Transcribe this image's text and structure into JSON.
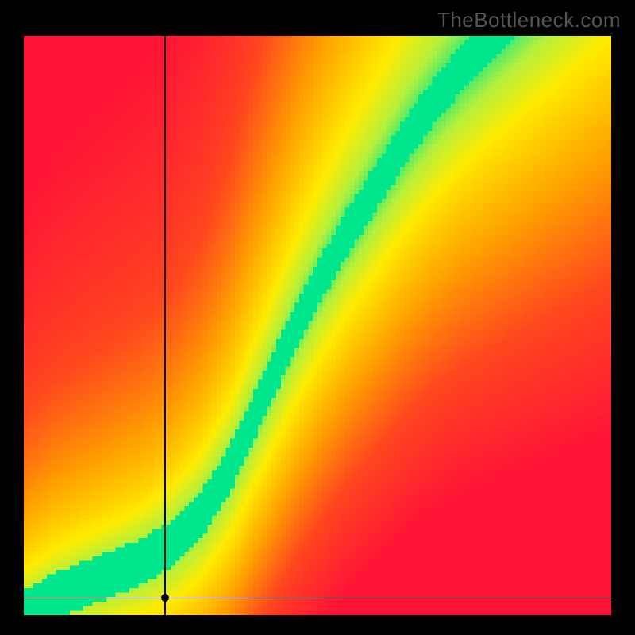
{
  "watermark": "TheBottleneck.com",
  "chart_data": {
    "type": "heatmap",
    "title": "",
    "xlabel": "",
    "ylabel": "",
    "xlim": [
      0,
      100
    ],
    "ylim": [
      0,
      100
    ],
    "grid_cells": 128,
    "colormap_description": "red→orange→yellow→green (distance from optimal curve)",
    "optimal_curve": [
      {
        "x": 0,
        "y": 0
      },
      {
        "x": 5,
        "y": 3
      },
      {
        "x": 10,
        "y": 5
      },
      {
        "x": 15,
        "y": 7
      },
      {
        "x": 20,
        "y": 9
      },
      {
        "x": 25,
        "y": 12
      },
      {
        "x": 30,
        "y": 17
      },
      {
        "x": 35,
        "y": 25
      },
      {
        "x": 40,
        "y": 36
      },
      {
        "x": 45,
        "y": 47
      },
      {
        "x": 50,
        "y": 57
      },
      {
        "x": 55,
        "y": 66
      },
      {
        "x": 60,
        "y": 74
      },
      {
        "x": 65,
        "y": 82
      },
      {
        "x": 70,
        "y": 89
      },
      {
        "x": 75,
        "y": 95
      },
      {
        "x": 80,
        "y": 100
      }
    ],
    "curve_band_width_pct": 4,
    "crosshair": {
      "x": 24,
      "y": 3
    }
  }
}
